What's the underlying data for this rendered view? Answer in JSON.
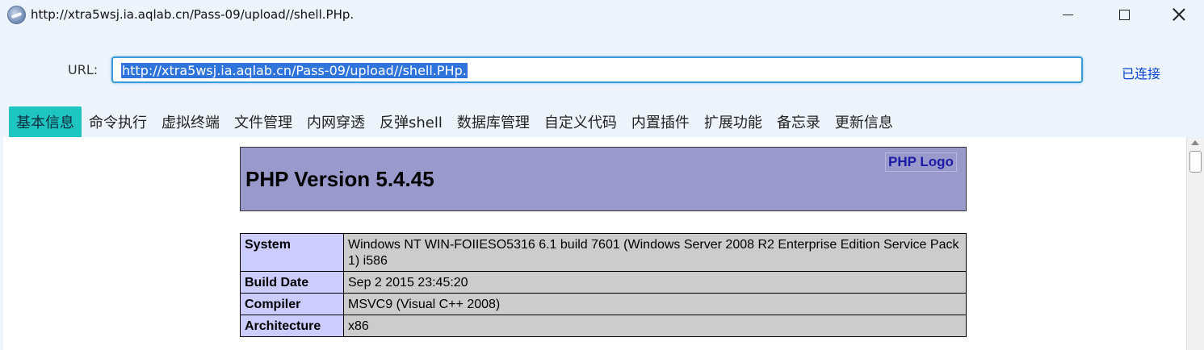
{
  "window": {
    "title": "http://xtra5wsj.ia.aqlab.cn/Pass-09/upload//shell.PHp.",
    "app_icon": "globe-app-icon",
    "controls": [
      "minimize-icon",
      "maximize-icon",
      "close-icon"
    ]
  },
  "url_bar": {
    "label": "URL:",
    "value": "http://xtra5wsj.ia.aqlab.cn/Pass-09/upload//shell.PHp.",
    "status": "已连接"
  },
  "tabs": [
    {
      "label": "基本信息",
      "active": true
    },
    {
      "label": "命令执行"
    },
    {
      "label": "虚拟终端"
    },
    {
      "label": "文件管理"
    },
    {
      "label": "内网穿透"
    },
    {
      "label": "反弹shell"
    },
    {
      "label": "数据库管理"
    },
    {
      "label": "自定义代码"
    },
    {
      "label": "内置插件"
    },
    {
      "label": "扩展功能"
    },
    {
      "label": "备忘录"
    },
    {
      "label": "更新信息"
    }
  ],
  "phpinfo": {
    "version_title": "PHP Version 5.4.45",
    "logo_alt": "PHP Logo",
    "rows": [
      {
        "key": "System",
        "value": "Windows NT WIN-FOIIESO5316 6.1 build 7601 (Windows Server 2008 R2 Enterprise Edition Service Pack 1) i586"
      },
      {
        "key": "Build Date",
        "value": "Sep 2 2015 23:45:20"
      },
      {
        "key": "Compiler",
        "value": "MSVC9 (Visual C++ 2008)"
      },
      {
        "key": "Architecture",
        "value": "x86"
      }
    ]
  },
  "colors": {
    "active_tab": "#1fc5c0",
    "php_header": "#9999cc",
    "key_cell": "#ccccff",
    "value_cell": "#cccccc",
    "link": "#0645d6"
  }
}
